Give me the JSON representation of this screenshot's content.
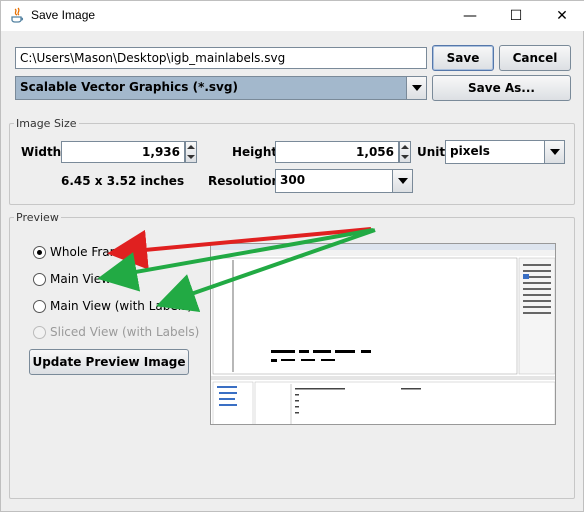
{
  "window": {
    "title": "Save Image",
    "minimize_glyph": "—",
    "maximize_glyph": "☐",
    "close_glyph": "✕"
  },
  "file": {
    "path": "C:\\Users\\Mason\\Desktop\\igb_mainlabels.svg",
    "format": "Scalable Vector Graphics (*.svg)",
    "save_label": "Save",
    "cancel_label": "Cancel",
    "save_as_label": "Save As..."
  },
  "image_size": {
    "legend": "Image Size",
    "width_label": "Width:",
    "width_value": "1,936",
    "height_label": "Height:",
    "height_value": "1,056",
    "unit_label": "Unit:",
    "unit_value": "pixels",
    "inches_text": "6.45 x 3.52 inches",
    "resolution_label": "Resolution:",
    "resolution_value": "300"
  },
  "preview": {
    "legend": "Preview",
    "options": [
      {
        "label": "Whole Frame",
        "selected": true,
        "enabled": true
      },
      {
        "label": "Main View",
        "selected": false,
        "enabled": true
      },
      {
        "label": "Main View (with Labels)",
        "selected": false,
        "enabled": true
      },
      {
        "label": "Sliced View (with Labels)",
        "selected": false,
        "enabled": false
      }
    ],
    "update_label": "Update Preview Image"
  },
  "annotation_colors": {
    "red_arrow": "#e02020",
    "green_arrow": "#22aa44"
  }
}
